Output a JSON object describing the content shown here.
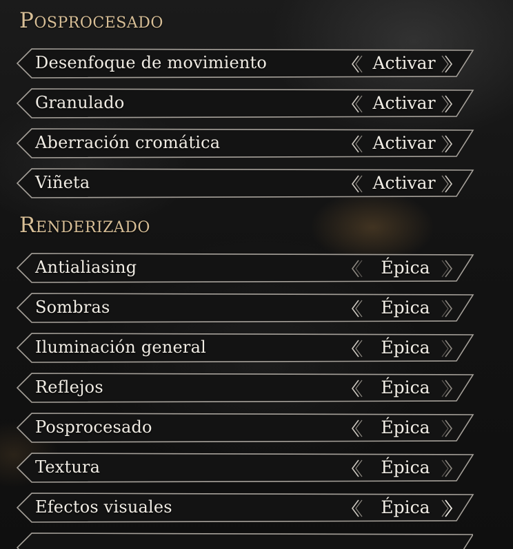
{
  "sections": [
    {
      "title": "Posprocesado",
      "rows": [
        {
          "label": "Desenfoque de movimiento",
          "value": "Activar"
        },
        {
          "label": "Granulado",
          "value": "Activar"
        },
        {
          "label": "Aberración cromática",
          "value": "Activar"
        },
        {
          "label": "Viñeta",
          "value": "Activar"
        }
      ]
    },
    {
      "title": "Renderizado",
      "rows": [
        {
          "label": "Antialiasing",
          "value": "Épica"
        },
        {
          "label": "Sombras",
          "value": "Épica"
        },
        {
          "label": "Iluminación general",
          "value": "Épica"
        },
        {
          "label": "Reflejos",
          "value": "Épica"
        },
        {
          "label": "Posprocesado",
          "value": "Épica"
        },
        {
          "label": "Textura",
          "value": "Épica"
        },
        {
          "label": "Efectos visuales",
          "value": "Épica"
        }
      ]
    }
  ],
  "icons": {
    "previous": "chevron-left-icon",
    "next": "chevron-right-icon"
  },
  "colors": {
    "section_title": "#d8bf97",
    "row_fill": "#131313",
    "row_border": "#a7a29b",
    "text": "#f0ece4"
  }
}
